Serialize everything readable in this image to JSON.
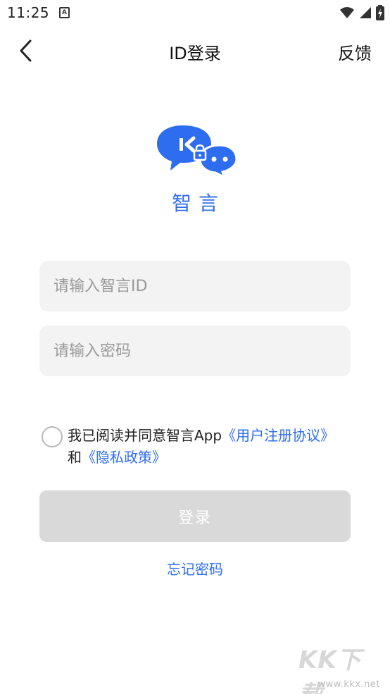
{
  "status_bar": {
    "time": "11:25",
    "app_icon_letter": "A"
  },
  "header": {
    "title": "ID登录",
    "feedback_label": "反馈"
  },
  "app": {
    "name": "智言",
    "brand_color": "#2f6df0"
  },
  "form": {
    "id_placeholder": "请输入智言ID",
    "id_value": "",
    "password_placeholder": "请输入密码",
    "password_value": "",
    "agreement": {
      "checked": false,
      "prefix": "我已阅读并同意智言App",
      "user_agreement_link": "《用户注册协议》",
      "conjunction": "和",
      "privacy_link": "《隐私政策》"
    },
    "login_label": "登录",
    "forgot_password_label": "忘记密码"
  },
  "watermark": {
    "logo_text": "KK下载",
    "url": "www.kkx.net"
  },
  "icons": {
    "back": "chevron-left-icon",
    "wifi": "wifi-icon",
    "signal": "signal-icon",
    "battery": "battery-icon",
    "logo": "chat-bubbles-lock-icon"
  }
}
